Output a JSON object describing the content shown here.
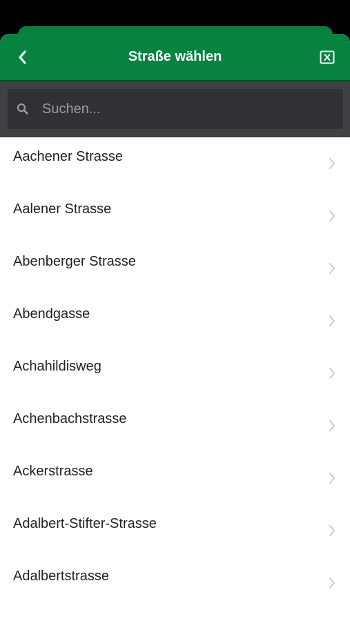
{
  "header": {
    "title": "Straße wählen",
    "back_icon": "chevron-left-icon",
    "close_icon": "close-box-icon"
  },
  "search": {
    "placeholder": "Suchen...",
    "value": "",
    "icon": "search-icon"
  },
  "streets": [
    "Aachener Strasse",
    "Aalener Strasse",
    "Abenberger Strasse",
    "Abendgasse",
    "Achahildisweg",
    "Achenbachstrasse",
    "Ackerstrasse",
    "Adalbert-Stifter-Strasse",
    "Adalbertstrasse"
  ],
  "colors": {
    "header_bg": "#06843f",
    "search_bar_bg": "#3f4145",
    "search_field_bg": "#2f3135",
    "list_bg": "#ffffff",
    "chevron": "#c7c7cc"
  }
}
